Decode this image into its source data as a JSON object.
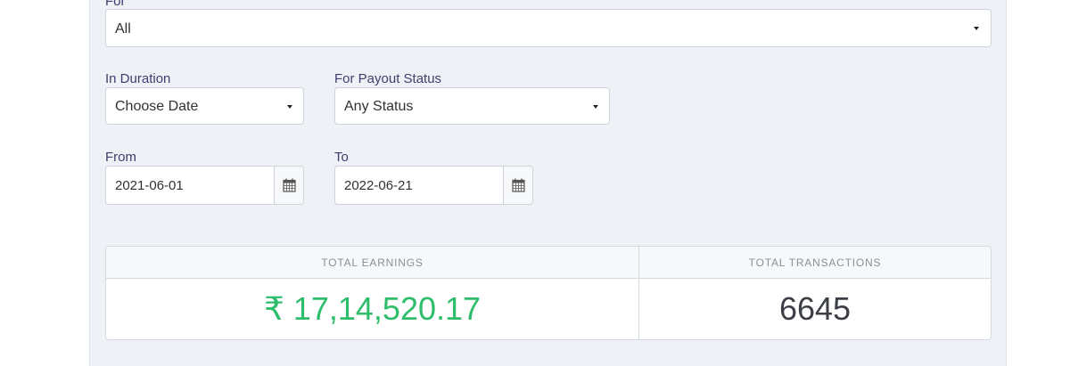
{
  "filters": {
    "for": {
      "label": "For",
      "value": "All"
    },
    "duration": {
      "label": "In Duration",
      "value": "Choose Date"
    },
    "payout_status": {
      "label": "For Payout Status",
      "value": "Any Status"
    },
    "from": {
      "label": "From",
      "value": "2021-06-01"
    },
    "to": {
      "label": "To",
      "value": "2022-06-21"
    }
  },
  "summary": {
    "earnings": {
      "label": "TOTAL EARNINGS",
      "value": "₹ 17,14,520.17",
      "color": "#2ebd6b"
    },
    "transactions": {
      "label": "TOTAL TRANSACTIONS",
      "value": "6645",
      "color": "#3b3e45"
    }
  },
  "icons": {
    "dropdown": "caret-down-icon",
    "date_picker": "calendar-icon"
  }
}
